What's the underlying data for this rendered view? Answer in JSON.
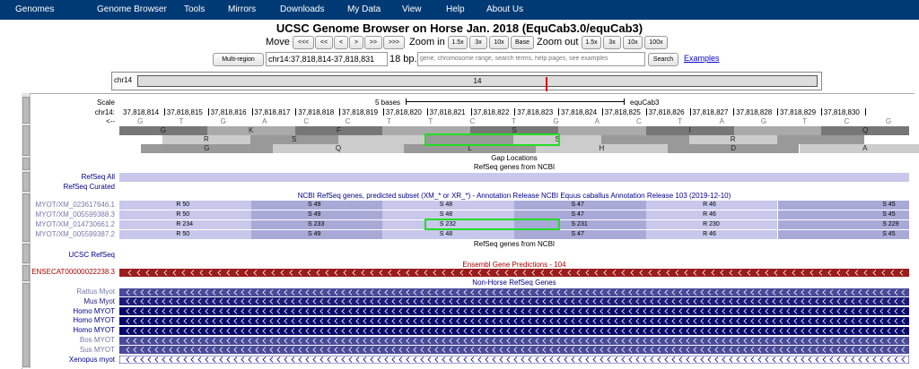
{
  "navbar": {
    "items": [
      "Genomes",
      "Genome Browser",
      "Tools",
      "Mirrors",
      "Downloads",
      "My Data",
      "View",
      "Help",
      "About Us"
    ]
  },
  "title": "UCSC Genome Browser on Horse Jan. 2018 (EquCab3.0/equCab3)",
  "move": {
    "label": "Move",
    "buttons": [
      "<<<",
      "<<",
      "<",
      ">",
      ">>",
      ">>>"
    ],
    "zoom_in_label": "Zoom in",
    "zoom_in": [
      "1.5x",
      "3x",
      "10x",
      "Base"
    ],
    "zoom_out_label": "Zoom out",
    "zoom_out": [
      "1.5x",
      "3x",
      "10x",
      "100x"
    ]
  },
  "search": {
    "multi_region": "Multi-region",
    "position": "chr14:37,818,814-37,818,831",
    "bp": "18 bp.",
    "placeholder": "gene, chromosome range, search terms, help pages, see examples",
    "search_button": "Search",
    "examples_link": "Examples"
  },
  "ideogram": {
    "chrom": "chr14",
    "band": "14"
  },
  "tracks": {
    "scale_label": "Scale",
    "chrom_label": "chr14:",
    "arrow_label": "<--",
    "scale_text": "5 bases",
    "assembly": "equCab3",
    "positions": [
      "37,818,814",
      "37,818,815",
      "37,818,816",
      "37,818,817",
      "37,818,818",
      "37,818,819",
      "37,818,820",
      "37,818,821",
      "37,818,822",
      "37,818,823",
      "37,818,824",
      "37,818,825",
      "37,818,826",
      "37,818,827",
      "37,818,828",
      "37,818,829",
      "37,818,830"
    ],
    "bases": [
      "G",
      "T",
      "G",
      "A",
      "C",
      "C",
      "T",
      "T",
      "C",
      "T",
      "G",
      "A",
      "C",
      "T",
      "A",
      "G",
      "T",
      "C",
      "G"
    ],
    "aa_row1": [
      "G",
      "K",
      "F",
      "",
      "S",
      "",
      "I",
      "",
      "Q"
    ],
    "aa_row2": [
      "R",
      "S",
      "",
      "",
      "S",
      "",
      "R",
      ""
    ],
    "aa_row3": [
      "G",
      "Q",
      "L",
      "H",
      "D",
      "A"
    ],
    "gap_locations": "Gap Locations",
    "refseq_from_ncbi": "RefSeq genes from NCBI",
    "refseq_all": "RefSeq All",
    "refseq_curated": "RefSeq Curated",
    "ncbi_predicted": "NCBI RefSeq genes, predicted subset (XM_* or XR_*) - Annotation Release NCBI Equus caballus Annotation Release 103 (2019-12-10)",
    "transcripts": [
      {
        "name": "MYOT/XM_023617646.1",
        "labels": [
          "R 50",
          "S 49",
          "S 48",
          "S 47",
          "R 46",
          "S 45"
        ]
      },
      {
        "name": "MYOT/XM_005599388.3",
        "labels": [
          "R 50",
          "S 49",
          "S 48",
          "S 47",
          "R 46",
          "S 45"
        ]
      },
      {
        "name": "MYOT/XM_014730661.2",
        "labels": [
          "R 234",
          "S 233",
          "S 232",
          "S 231",
          "R 230",
          "S 229"
        ]
      },
      {
        "name": "MYOT/XM_005599387.2",
        "labels": [
          "R 50",
          "S 49",
          "S 48",
          "S 47",
          "R 46",
          "S 45"
        ]
      }
    ],
    "refseq_from_ncbi_2": "RefSeq genes from NCBI",
    "ucsc_refseq": "UCSC RefSeq",
    "ensembl": "Ensembl Gene Predictions - 104",
    "ensembl_gene": "ENSECAT00000022238.3",
    "non_horse": "Non-Horse RefSeq Genes",
    "other_species": [
      "Rattus Myot",
      "Mus Myot",
      "Homo MYOT",
      "Homo MYOT",
      "Homo MYOT",
      "Bos MYOT",
      "Sus MYOT",
      "Xenopus myot"
    ]
  },
  "colors": {
    "navbar": "#003a74",
    "refseq_dark": "#a9a9d8",
    "refseq_light": "#c8c8ec",
    "ensembl": "#9b1c1c",
    "nonhorse": "#1c1c7a",
    "highlight": "#22dd22"
  }
}
